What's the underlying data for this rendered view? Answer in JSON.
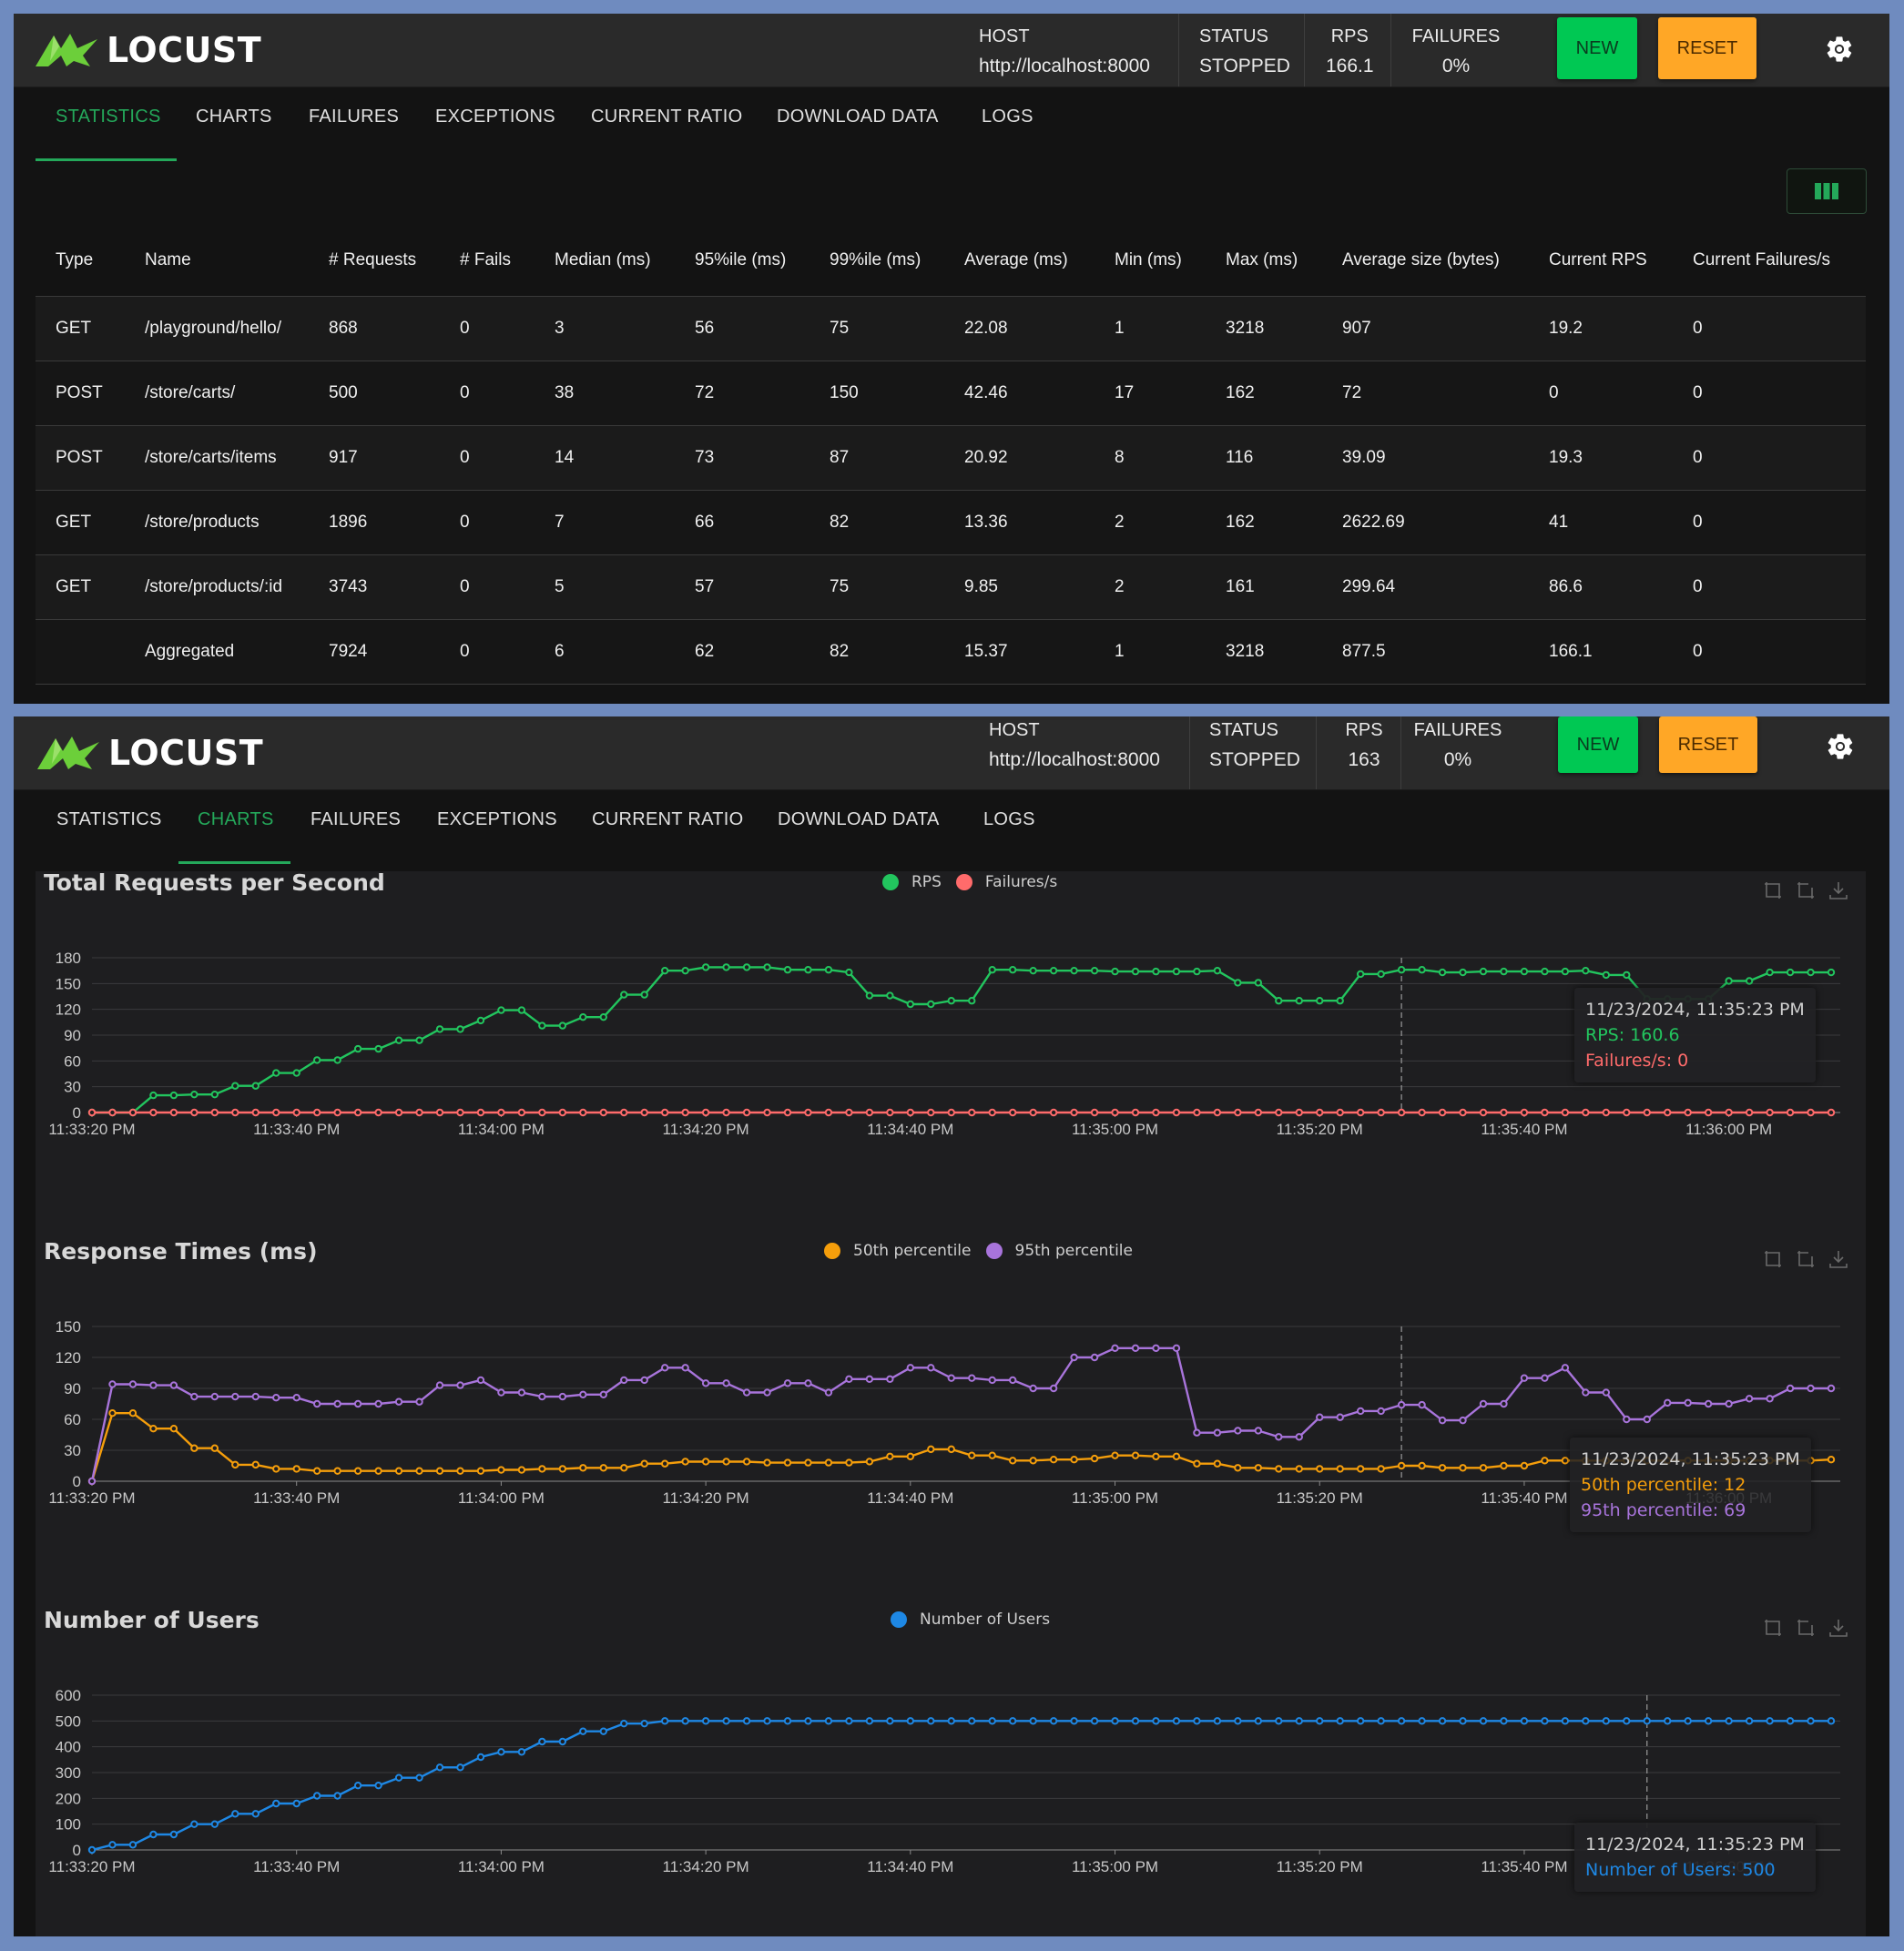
{
  "app": {
    "logo_text": "LOCUST",
    "host_label": "HOST",
    "host_value": "http://localhost:8000",
    "status_label": "STATUS",
    "status_value": "STOPPED",
    "rps_label": "RPS",
    "failures_label": "FAILURES",
    "failures_value": "0%",
    "new_label": "NEW",
    "reset_label": "RESET",
    "accent": "#24a85a",
    "new_color": "#00c853",
    "reset_color": "#ffa726"
  },
  "panel1": {
    "rps_value": "166.1"
  },
  "panel2": {
    "rps_value": "163"
  },
  "tabs": [
    "STATISTICS",
    "CHARTS",
    "FAILURES",
    "EXCEPTIONS",
    "CURRENT RATIO",
    "DOWNLOAD DATA",
    "LOGS"
  ],
  "stats_table": {
    "headers": [
      "Type",
      "Name",
      "# Requests",
      "# Fails",
      "Median (ms)",
      "95%ile (ms)",
      "99%ile (ms)",
      "Average (ms)",
      "Min (ms)",
      "Max (ms)",
      "Average size (bytes)",
      "Current RPS",
      "Current Failures/s"
    ],
    "rows": [
      [
        "GET",
        "/playground/hello/",
        "868",
        "0",
        "3",
        "56",
        "75",
        "22.08",
        "1",
        "3218",
        "907",
        "19.2",
        "0"
      ],
      [
        "POST",
        "/store/carts/",
        "500",
        "0",
        "38",
        "72",
        "150",
        "42.46",
        "17",
        "162",
        "72",
        "0",
        "0"
      ],
      [
        "POST",
        "/store/carts/items",
        "917",
        "0",
        "14",
        "73",
        "87",
        "20.92",
        "8",
        "116",
        "39.09",
        "19.3",
        "0"
      ],
      [
        "GET",
        "/store/products",
        "1896",
        "0",
        "7",
        "66",
        "82",
        "13.36",
        "2",
        "162",
        "2622.69",
        "41",
        "0"
      ],
      [
        "GET",
        "/store/products/:id",
        "3743",
        "0",
        "5",
        "57",
        "75",
        "9.85",
        "2",
        "161",
        "299.64",
        "86.6",
        "0"
      ],
      [
        "",
        "Aggregated",
        "7924",
        "0",
        "6",
        "62",
        "82",
        "15.37",
        "1",
        "3218",
        "877.5",
        "166.1",
        "0"
      ]
    ]
  },
  "charts": {
    "x_ticks": [
      "11:33:20 PM",
      "11:33:40 PM",
      "11:34:00 PM",
      "11:34:20 PM",
      "11:34:40 PM",
      "11:35:00 PM",
      "11:35:20 PM",
      "11:35:40 PM",
      "11:36:00 PM"
    ],
    "rps_chart": {
      "title": "Total Requests per Second",
      "legend": [
        "RPS",
        "Failures/s"
      ],
      "tooltip": {
        "time": "11/23/2024, 11:35:23 PM",
        "line1": "RPS: 160.6",
        "line2": "Failures/s: 0"
      }
    },
    "response_chart": {
      "title": "Response Times (ms)",
      "legend": [
        "50th percentile",
        "95th percentile"
      ],
      "tooltip": {
        "time": "11/23/2024, 11:35:23 PM",
        "line1": "50th percentile: 12",
        "line2": "95th percentile: 69"
      }
    },
    "users_chart": {
      "title": "Number of Users",
      "legend": [
        "Number of Users"
      ],
      "tooltip": {
        "time": "11/23/2024, 11:35:23 PM",
        "line1": "Number of Users: 500"
      }
    }
  },
  "chart_data": [
    {
      "type": "line",
      "title": "Total Requests per Second",
      "x_start": "11:33:20 PM",
      "x_step_seconds": 2,
      "x_ticks": [
        "11:33:20 PM",
        "11:33:40 PM",
        "11:34:00 PM",
        "11:34:20 PM",
        "11:34:40 PM",
        "11:35:00 PM",
        "11:35:20 PM",
        "11:35:40 PM",
        "11:36:00 PM"
      ],
      "ylim": [
        0,
        180
      ],
      "y_ticks": [
        0,
        30,
        60,
        90,
        120,
        150,
        180
      ],
      "grid": true,
      "legend_position": "top-center",
      "series": [
        {
          "name": "RPS",
          "color": "#22c55e",
          "values": [
            0,
            0,
            0,
            20,
            20,
            21,
            21,
            31,
            31,
            46,
            46,
            61,
            61,
            74,
            74,
            84,
            84,
            97,
            97,
            107,
            119,
            119,
            101,
            101,
            111,
            111,
            137,
            137,
            165,
            165,
            169,
            169,
            169,
            169,
            166,
            166,
            166,
            163,
            136,
            136,
            126,
            126,
            130,
            130,
            166,
            166,
            165,
            165,
            165,
            165,
            164,
            164,
            164,
            164,
            164,
            165,
            151,
            151,
            130,
            130,
            130,
            130,
            161,
            161,
            166,
            166,
            163,
            163,
            164,
            164,
            164,
            164,
            164,
            165,
            160,
            160,
            132,
            132,
            132,
            132,
            153,
            153,
            163,
            163,
            163,
            163
          ]
        },
        {
          "name": "Failures/s",
          "color": "#ff6b6b",
          "values": [
            0,
            0,
            0,
            0,
            0,
            0,
            0,
            0,
            0,
            0,
            0,
            0,
            0,
            0,
            0,
            0,
            0,
            0,
            0,
            0,
            0,
            0,
            0,
            0,
            0,
            0,
            0,
            0,
            0,
            0,
            0,
            0,
            0,
            0,
            0,
            0,
            0,
            0,
            0,
            0,
            0,
            0,
            0,
            0,
            0,
            0,
            0,
            0,
            0,
            0,
            0,
            0,
            0,
            0,
            0,
            0,
            0,
            0,
            0,
            0,
            0,
            0,
            0,
            0,
            0,
            0,
            0,
            0,
            0,
            0,
            0,
            0,
            0,
            0,
            0,
            0,
            0,
            0,
            0,
            0,
            0,
            0,
            0,
            0,
            0,
            0
          ]
        }
      ]
    },
    {
      "type": "line",
      "title": "Response Times (ms)",
      "x_start": "11:33:20 PM",
      "x_step_seconds": 2,
      "x_ticks": [
        "11:33:20 PM",
        "11:33:40 PM",
        "11:34:00 PM",
        "11:34:20 PM",
        "11:34:40 PM",
        "11:35:00 PM",
        "11:35:20 PM",
        "11:35:40 PM",
        "11:36:00 PM"
      ],
      "ylim": [
        0,
        150
      ],
      "y_ticks": [
        0,
        30,
        60,
        90,
        120,
        150
      ],
      "grid": true,
      "legend_position": "top-center",
      "series": [
        {
          "name": "50th percentile",
          "color": "#f59e0b",
          "values": [
            0,
            66,
            66,
            51,
            51,
            32,
            32,
            16,
            16,
            12,
            12,
            10,
            10,
            10,
            10,
            10,
            10,
            10,
            10,
            10,
            11,
            11,
            12,
            12,
            13,
            13,
            13,
            17,
            17,
            19,
            19,
            19,
            19,
            18,
            18,
            18,
            18,
            18,
            19,
            24,
            24,
            31,
            31,
            25,
            25,
            20,
            20,
            21,
            21,
            22,
            25,
            25,
            24,
            24,
            17,
            17,
            13,
            13,
            12,
            12,
            12,
            12,
            12,
            12,
            15,
            15,
            13,
            13,
            13,
            15,
            15,
            20,
            20,
            20,
            20,
            20,
            20,
            20,
            20,
            20,
            20,
            20,
            20,
            20,
            20,
            21
          ]
        },
        {
          "name": "95th percentile",
          "color": "#a874db",
          "values": [
            0,
            94,
            94,
            93,
            93,
            82,
            82,
            82,
            82,
            81,
            81,
            75,
            75,
            75,
            75,
            77,
            77,
            93,
            93,
            98,
            86,
            86,
            82,
            82,
            84,
            84,
            98,
            98,
            110,
            110,
            95,
            95,
            86,
            86,
            95,
            95,
            86,
            99,
            99,
            99,
            110,
            110,
            100,
            100,
            98,
            98,
            90,
            90,
            120,
            120,
            129,
            129,
            129,
            129,
            47,
            47,
            49,
            49,
            43,
            43,
            62,
            62,
            68,
            68,
            74,
            74,
            59,
            59,
            75,
            75,
            100,
            100,
            110,
            86,
            86,
            60,
            60,
            76,
            76,
            75,
            75,
            80,
            80,
            90,
            90,
            90
          ]
        }
      ]
    },
    {
      "type": "line",
      "title": "Number of Users",
      "x_start": "11:33:20 PM",
      "x_step_seconds": 2,
      "x_ticks": [
        "11:33:20 PM",
        "11:33:40 PM",
        "11:34:00 PM",
        "11:34:20 PM",
        "11:34:40 PM",
        "11:35:00 PM",
        "11:35:20 PM",
        "11:35:40 PM",
        "11:36:00 PM"
      ],
      "ylim": [
        0,
        600
      ],
      "y_ticks": [
        0,
        100,
        200,
        300,
        400,
        500,
        600
      ],
      "grid": true,
      "legend_position": "top-center",
      "series": [
        {
          "name": "Number of Users",
          "color": "#1e88e5",
          "values": [
            0,
            20,
            20,
            60,
            60,
            100,
            100,
            140,
            140,
            180,
            180,
            210,
            210,
            250,
            250,
            280,
            280,
            320,
            320,
            360,
            380,
            380,
            420,
            420,
            460,
            460,
            490,
            490,
            500,
            500,
            500,
            500,
            500,
            500,
            500,
            500,
            500,
            500,
            500,
            500,
            500,
            500,
            500,
            500,
            500,
            500,
            500,
            500,
            500,
            500,
            500,
            500,
            500,
            500,
            500,
            500,
            500,
            500,
            500,
            500,
            500,
            500,
            500,
            500,
            500,
            500,
            500,
            500,
            500,
            500,
            500,
            500,
            500,
            500,
            500,
            500,
            500,
            500,
            500,
            500,
            500,
            500,
            500,
            500,
            500,
            500
          ]
        }
      ]
    }
  ]
}
